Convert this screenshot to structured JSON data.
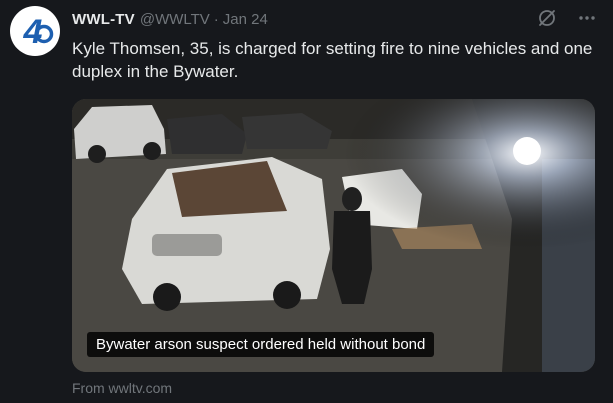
{
  "tweet": {
    "display_name": "WWL-TV",
    "handle": "@WWLTV",
    "separator": "·",
    "date": "Jan 24",
    "text": "Kyle Thomsen, 35, is charged for setting fire to nine vehicles and one duplex in the Bywater."
  },
  "avatar": {
    "icon": "wwltv-4-logo",
    "label": "4"
  },
  "actions": [
    {
      "icon": "grok-icon"
    },
    {
      "icon": "more-icon"
    }
  ],
  "media": {
    "caption": "Bywater arson suspect ordered held without bond",
    "source": "From wwltv.com"
  },
  "colors": {
    "background": "#16181c",
    "text": "#e7e9ea",
    "secondary": "#71767b",
    "logo_blue": "#1d5fb0"
  }
}
